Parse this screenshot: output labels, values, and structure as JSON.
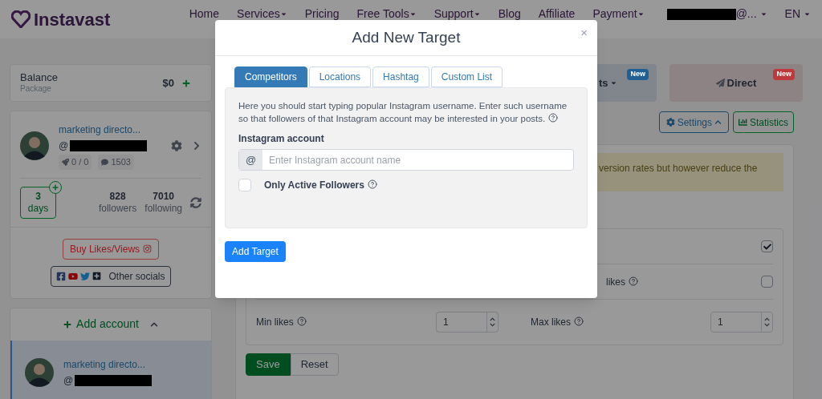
{
  "nav": {
    "logo": "Instavast",
    "links": [
      {
        "label": "Home",
        "dropdown": false
      },
      {
        "label": "Services",
        "dropdown": true
      },
      {
        "label": "Pricing",
        "dropdown": false
      },
      {
        "label": "Free Tools",
        "dropdown": true
      },
      {
        "label": "Support",
        "dropdown": true
      },
      {
        "label": "Blog",
        "dropdown": false
      },
      {
        "label": "Affiliate",
        "dropdown": false
      },
      {
        "label": "Payment",
        "dropdown": true
      }
    ],
    "account": {
      "label": "@...",
      "dropdown": true
    },
    "language": {
      "label": "EN",
      "dropdown": true
    }
  },
  "sidebar": {
    "balance": {
      "label": "Balance",
      "sublabel": "Package",
      "amount": "$0"
    },
    "account": {
      "name": "marketing directo...",
      "handle_prefix": "@",
      "badges": [
        {
          "kind": "rocket",
          "text": "0 / 0"
        },
        {
          "kind": "comments",
          "text": "1503"
        }
      ],
      "days": {
        "value": "3",
        "unit": "days"
      },
      "stats": [
        {
          "value": "828",
          "label": "followers"
        },
        {
          "value": "7010",
          "label": "following"
        }
      ],
      "buy_button": "Buy Likes/Views",
      "socials_button": "Other socials"
    },
    "add_account": {
      "label": "Add account",
      "expanded": true
    },
    "accounts": [
      {
        "name": "marketing directo...",
        "handle_prefix": "@",
        "selected": true
      }
    ]
  },
  "main": {
    "tiles": [
      {
        "label": "ts",
        "badge": "New",
        "color": "#1f5f94",
        "dropdown": true
      },
      {
        "label": "Direct",
        "badge": "New",
        "color": "#c0393a",
        "dropdown": false
      }
    ],
    "settings_button": {
      "label": "Settings",
      "expanded": true
    },
    "statistics_button": "Statistics",
    "alert": "version rates but however reduce the",
    "rows": [
      {
        "kind": "checkbox",
        "checked": true
      },
      {
        "kind": "checkbox",
        "label": "likes",
        "checked": false
      },
      {
        "kind": "range",
        "fields": [
          {
            "label": "Min likes",
            "value": "1"
          },
          {
            "label": "Max likes",
            "value": "1"
          }
        ]
      }
    ],
    "buttons": [
      {
        "label": "Save",
        "kind": "primary"
      },
      {
        "label": "Reset",
        "kind": "secondary"
      }
    ]
  },
  "modal": {
    "title": "Add New Target",
    "close": "×",
    "tabs": [
      {
        "label": "Competitors",
        "selected": true
      },
      {
        "label": "Locations",
        "selected": false
      },
      {
        "label": "Hashtag",
        "selected": false
      },
      {
        "label": "Custom List",
        "selected": false
      }
    ],
    "description": "Here you should start typing popular Instagram username. Enter such username so that followers of that Instagram account may be interested in your posts.",
    "field_label": "Instagram account",
    "addon": "@",
    "placeholder": "Enter Instagram account name",
    "checkbox": {
      "label": "Only Active Followers",
      "checked": false
    },
    "submit": "Add Target"
  }
}
